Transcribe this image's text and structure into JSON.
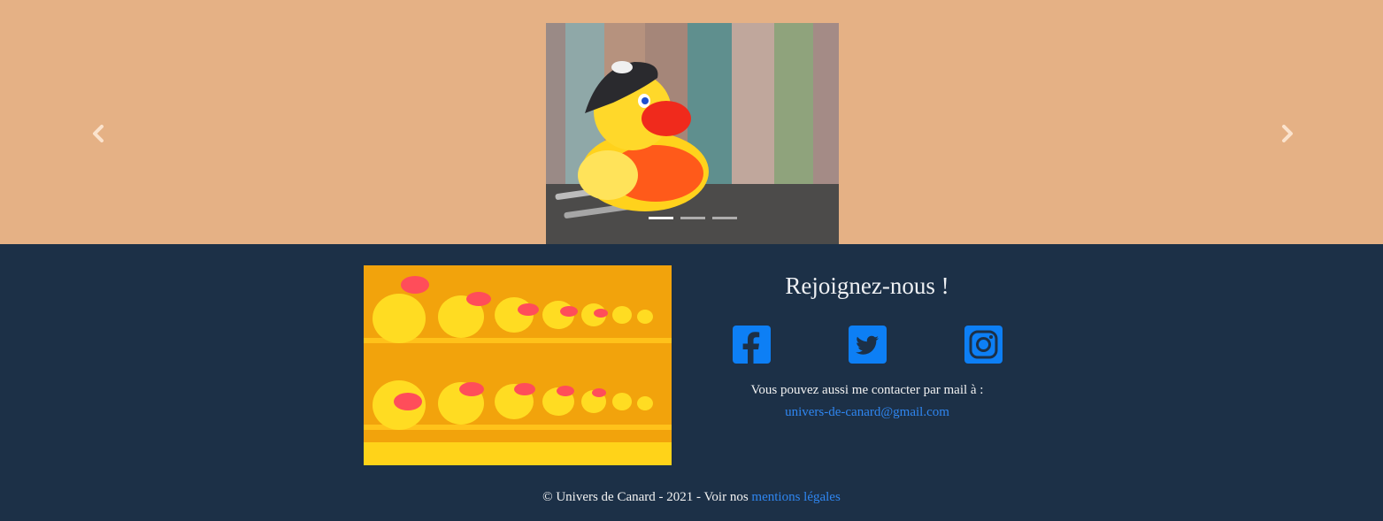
{
  "colors": {
    "carousel_bg": "#e5b185",
    "footer_bg": "#1c3047",
    "link": "#2f86f0",
    "social_icon": "#0d7ff5"
  },
  "carousel": {
    "slide_count": 3,
    "active_index": 0,
    "prev_icon": "chevron-left-icon",
    "next_icon": "chevron-right-icon"
  },
  "join": {
    "title": "Rejoignez-nous !",
    "socials": [
      {
        "icon": "facebook-icon"
      },
      {
        "icon": "twitter-icon"
      },
      {
        "icon": "instagram-icon"
      }
    ]
  },
  "contact": {
    "text": "Vous pouvez aussi me contacter par mail à :",
    "email": "univers-de-canard@gmail.com"
  },
  "footer": {
    "copyright_text": "© Univers de Canard - 2021 - Voir nos ",
    "legal_link": "mentions légales"
  }
}
